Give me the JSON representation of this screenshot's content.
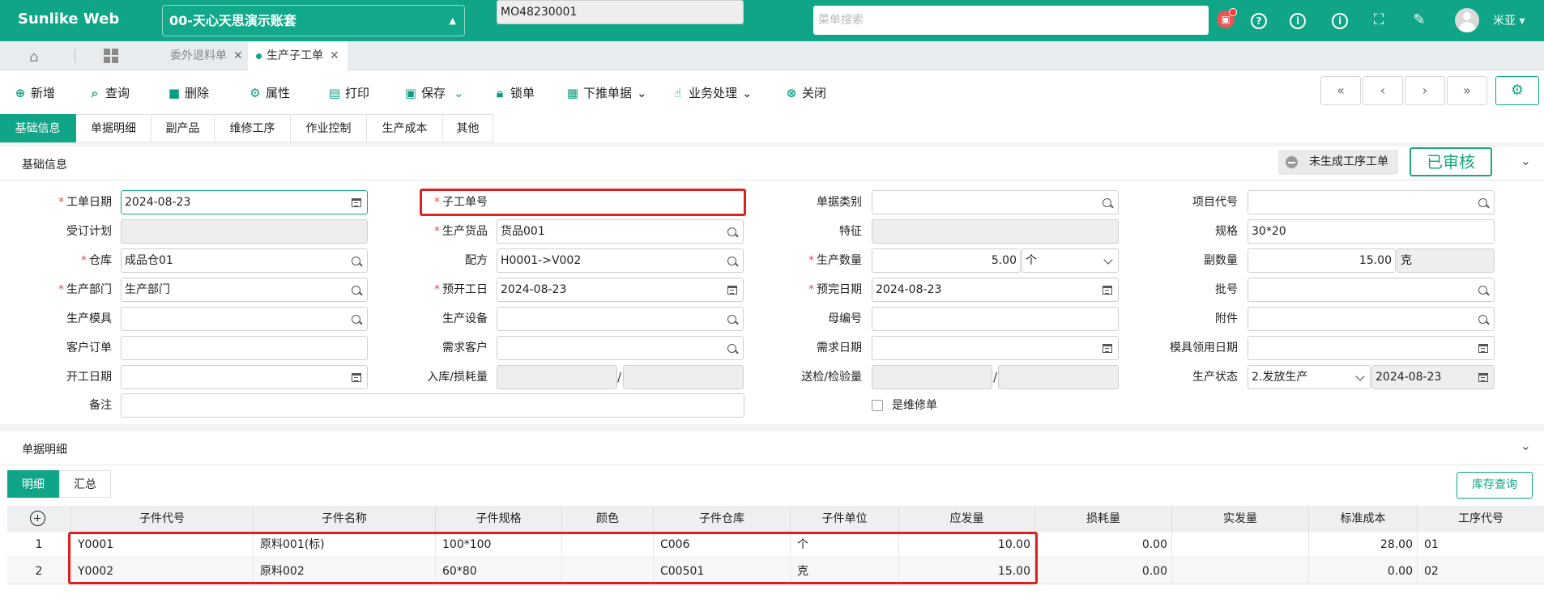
{
  "topbar": {
    "logo": "Sunlike Web",
    "account": "00-天心天思演示账套",
    "search_placeholder": "菜单搜索",
    "username": "米亚",
    "badge_icon": "notice-icon"
  },
  "doc_tabs": [
    {
      "label": "委外退料单"
    },
    {
      "label": "生产子工单"
    }
  ],
  "toolbar": {
    "new": "新增",
    "query": "查询",
    "delete": "删除",
    "props": "属性",
    "print": "打印",
    "save": "保存",
    "lock": "锁单",
    "push": "下推单据",
    "biz": "业务处理",
    "close": "关闭"
  },
  "section_tabs": [
    "基础信息",
    "单据明细",
    "副产品",
    "维修工序",
    "作业控制",
    "生产成本",
    "其他"
  ],
  "basic": {
    "title": "基础信息",
    "status_btn": "未生成工序工单",
    "approved": "已审核",
    "fields": {
      "order_date": {
        "label": "工单日期",
        "value": "2024-08-23"
      },
      "plan": {
        "label": "受订计划",
        "value": ""
      },
      "warehouse": {
        "label": "仓库",
        "value": "成品仓01"
      },
      "dept": {
        "label": "生产部门",
        "value": "生产部门"
      },
      "mold": {
        "label": "生产模具",
        "value": ""
      },
      "customer_order": {
        "label": "客户订单",
        "value": ""
      },
      "start_date": {
        "label": "开工日期",
        "value": ""
      },
      "remark": {
        "label": "备注",
        "value": ""
      },
      "sub_no": {
        "label": "子工单号",
        "value": "MO48230001"
      },
      "product": {
        "label": "生产货品",
        "value": "货品001"
      },
      "recipe": {
        "label": "配方",
        "value": "H0001->V002"
      },
      "plan_start": {
        "label": "预开工日",
        "value": "2024-08-23"
      },
      "equipment": {
        "label": "生产设备",
        "value": ""
      },
      "demand_customer": {
        "label": "需求客户",
        "value": ""
      },
      "in_loss": {
        "label": "入库/损耗量",
        "value1": "",
        "value2": ""
      },
      "doc_type": {
        "label": "单据类别",
        "value": ""
      },
      "feature": {
        "label": "特征",
        "value": ""
      },
      "qty": {
        "label": "生产数量",
        "value": "5.00",
        "unit": "个"
      },
      "plan_finish": {
        "label": "预完日期",
        "value": "2024-08-23"
      },
      "parent_no": {
        "label": "母编号",
        "value": ""
      },
      "demand_date": {
        "label": "需求日期",
        "value": ""
      },
      "inspect": {
        "label": "送检/检验量",
        "value1": "",
        "value2": ""
      },
      "repair": {
        "label": "是维修单"
      },
      "project": {
        "label": "项目代号",
        "value": ""
      },
      "spec": {
        "label": "规格",
        "value": "30*20"
      },
      "sub_qty": {
        "label": "副数量",
        "value": "15.00",
        "unit": "克"
      },
      "batch": {
        "label": "批号",
        "value": ""
      },
      "attachment": {
        "label": "附件",
        "value": ""
      },
      "mold_date": {
        "label": "模具领用日期",
        "value": ""
      },
      "prod_status": {
        "label": "生产状态",
        "value": "2.发放生产",
        "date": "2024-08-23"
      }
    }
  },
  "detail": {
    "title": "单据明细",
    "tabs": [
      "明细",
      "汇总"
    ],
    "stock_btn": "库存查询",
    "columns": [
      "子件代号",
      "子件名称",
      "子件规格",
      "颜色",
      "子件仓库",
      "子件单位",
      "应发量",
      "损耗量",
      "实发量",
      "标准成本",
      "工序代号"
    ],
    "rows": [
      {
        "no": "1",
        "code": "Y0001",
        "name": "原料001(标)",
        "spec": "100*100",
        "color": "",
        "wh": "C006",
        "unit": "个",
        "qty": "10.00",
        "loss": "0.00",
        "actual": "",
        "cost": "28.00",
        "op": "01"
      },
      {
        "no": "2",
        "code": "Y0002",
        "name": "原料002",
        "spec": "60*80",
        "color": "",
        "wh": "C00501",
        "unit": "克",
        "qty": "15.00",
        "loss": "0.00",
        "actual": "",
        "cost": "0.00",
        "op": "02"
      }
    ]
  },
  "colors": {
    "primary": "#0fa586",
    "highlight": "#e02020"
  }
}
